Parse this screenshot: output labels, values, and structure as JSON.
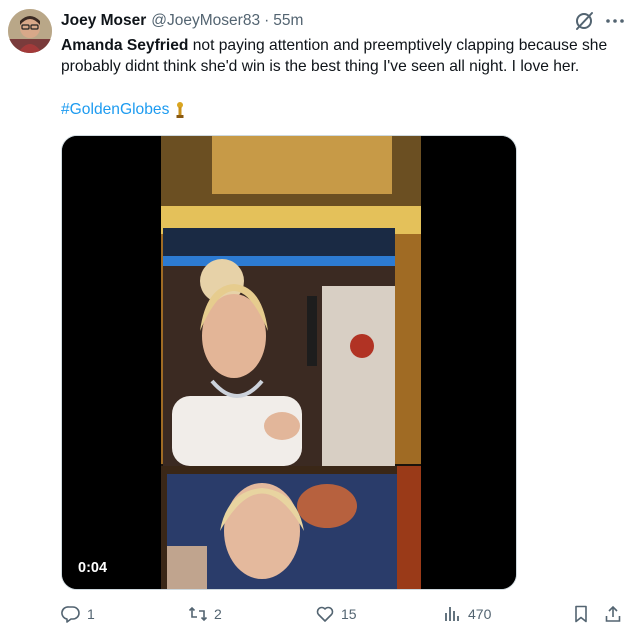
{
  "author": {
    "display_name": "Joey Moser",
    "handle": "@JoeyMoser83",
    "separator": "·",
    "time": "55m"
  },
  "tweet": {
    "mention_name": "Amanda Seyfried",
    "body": " not paying attention and preemptively clapping because she probably didnt think she'd win is the best thing I've seen all night. I love her.",
    "hashtag": "#GoldenGlobes"
  },
  "media": {
    "video_time": "0:04"
  },
  "actions": {
    "replies": "1",
    "reposts": "2",
    "likes": "15",
    "views": "470"
  },
  "icons": {
    "grok": "grok-icon",
    "more": "more-icon",
    "award": "golden-globe-icon",
    "reply": "reply-icon",
    "repost": "repost-icon",
    "like": "heart-icon",
    "views": "views-icon",
    "bookmark": "bookmark-icon",
    "share": "share-icon"
  },
  "colors": {
    "link": "#1d9bf0",
    "secondary_text": "#536471",
    "primary_text": "#0f1419"
  }
}
